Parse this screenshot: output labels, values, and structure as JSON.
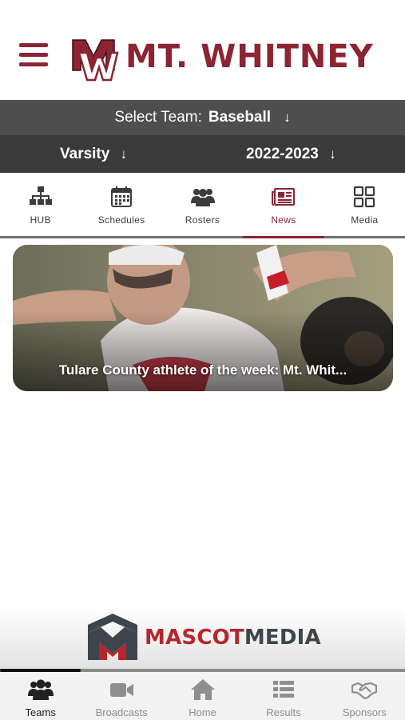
{
  "header": {
    "school_name": "MT. WHITNEY",
    "logo_initials": "MW",
    "brand_color": "#8c2433"
  },
  "team_select": {
    "label": "Select Team:",
    "team": "Baseball",
    "level": "Varsity",
    "season": "2022-2023",
    "arrow": "↓"
  },
  "tabs": [
    {
      "label": "HUB",
      "icon": "hierarchy-icon",
      "active": false
    },
    {
      "label": "Schedules",
      "icon": "calendar-icon",
      "active": false
    },
    {
      "label": "Rosters",
      "icon": "group-icon",
      "active": false
    },
    {
      "label": "News",
      "icon": "newspaper-icon",
      "active": true
    },
    {
      "label": "Media",
      "icon": "grid-icon",
      "active": false
    }
  ],
  "news": {
    "items": [
      {
        "title": "Tulare County athlete of the week: Mt. Whit..."
      }
    ]
  },
  "sponsor": {
    "brand_part1": "MASCOT",
    "brand_part2": "MEDIA",
    "colors": {
      "red": "#b8262d",
      "gray": "#3f454d"
    }
  },
  "carousel_progress": 0.2,
  "bottom_nav": [
    {
      "label": "Teams",
      "icon": "group-icon",
      "active": true
    },
    {
      "label": "Broadcasts",
      "icon": "video-camera-icon",
      "active": false
    },
    {
      "label": "Home",
      "icon": "home-icon",
      "active": false
    },
    {
      "label": "Results",
      "icon": "list-icon",
      "active": false
    },
    {
      "label": "Sponsors",
      "icon": "handshake-icon",
      "active": false
    }
  ]
}
